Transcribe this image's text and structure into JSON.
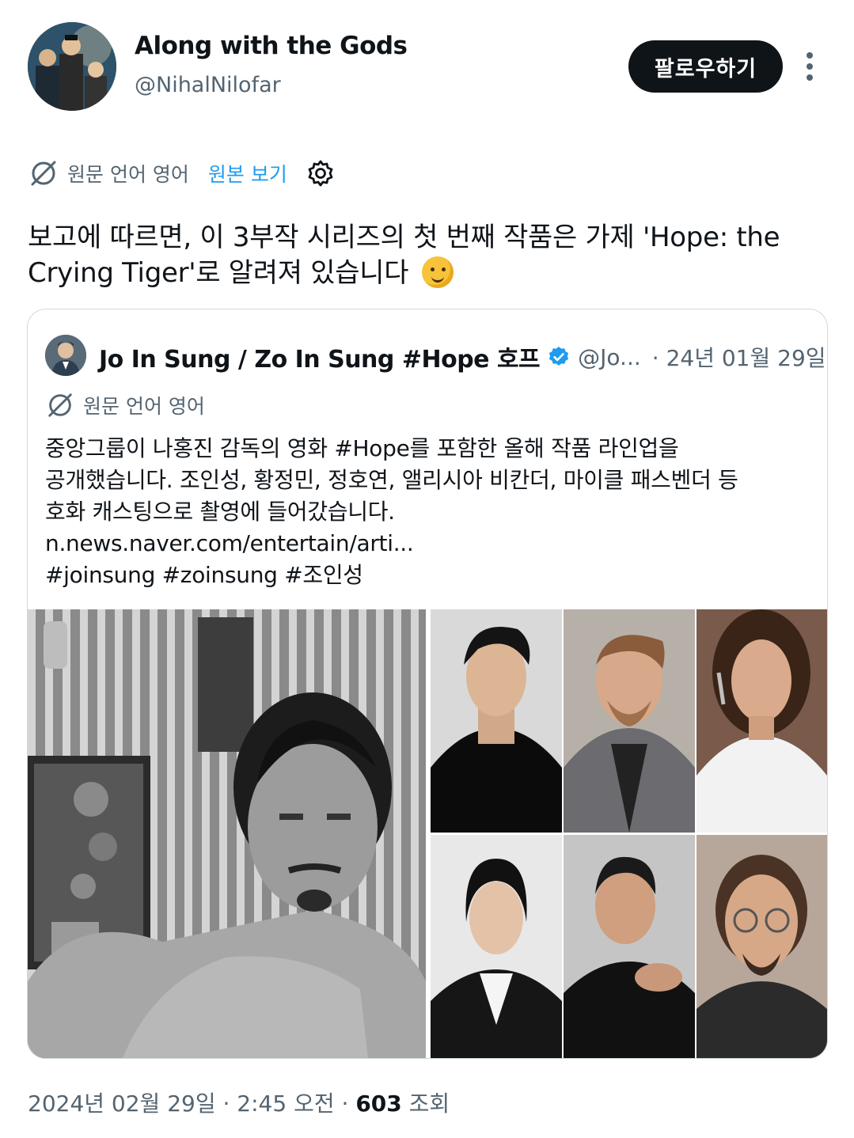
{
  "author": {
    "display_name": "Along with the Gods",
    "handle": "@NihalNilofar",
    "follow_label": "팔로우하기"
  },
  "translation": {
    "source_lang": "원문 언어 영어",
    "show_original": "원본 보기"
  },
  "tweet": {
    "line1": "보고에 따르면, 이 3부작 시리즈의 첫 번째 작품은 가제 'Hope: the",
    "line2": "Crying Tiger'로 알려져 있습니다"
  },
  "quoted": {
    "name": "Jo In Sung / Zo In Sung #Hope 호프",
    "handle": "@Jo...",
    "date": "· 24년 01월 29일",
    "source_lang": "원문 언어 영어",
    "lines": [
      "중앙그룹이 나홍진 감독의 영화 #Hope를 포함한 올해 작품 라인업을",
      "공개했습니다. 조인성, 황정민, 정호연, 앨리시아 비칸더, 마이클 패스벤더 등",
      "호화 캐스팅으로 촬영에 들어갔습니다.",
      "n.news.naver.com/entertain/arti...",
      "#joinsung #zoinsung #조인성"
    ]
  },
  "meta": {
    "timestamp": "2024년 02월 29일 · 2:45 오전 ·",
    "views": "603",
    "views_label": "조회"
  },
  "colors": {
    "link": "#1d9bf0",
    "muted": "#536471",
    "text": "#0f1419"
  }
}
